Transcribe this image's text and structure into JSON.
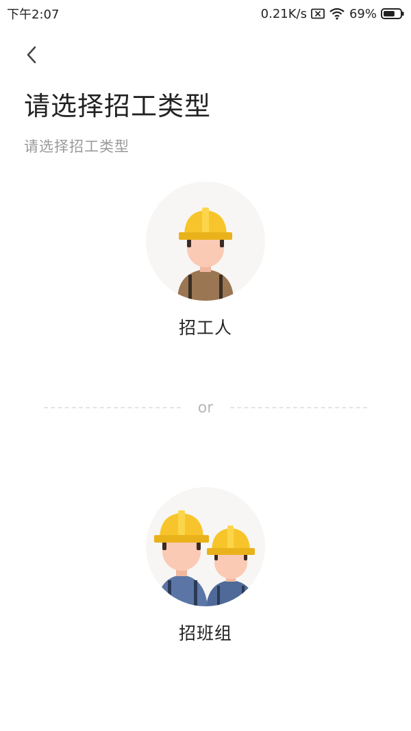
{
  "status_bar": {
    "time": "下午2:07",
    "network_speed": "0.21K/s",
    "battery_percent": "69%",
    "battery_level": 0.69,
    "icons": [
      "sim-x-icon",
      "wifi-icon",
      "battery-icon"
    ]
  },
  "header": {
    "back_icon": "chevron-left-icon",
    "title": "请选择招工类型",
    "subtitle": "请选择招工类型"
  },
  "options": [
    {
      "label": "招工人",
      "icon": "single-worker-icon"
    },
    {
      "label": "招班组",
      "icon": "worker-team-icon"
    }
  ],
  "divider_text": "or",
  "colors": {
    "helmet": "#f7c52b",
    "helmet_shade": "#e9b21b",
    "skin": "#fbcab5",
    "worker_shirt": "#9b7653",
    "team_shirt": "#4f6a99",
    "strap": "#2b3a55",
    "circle_bg": "#f7f6f4"
  }
}
